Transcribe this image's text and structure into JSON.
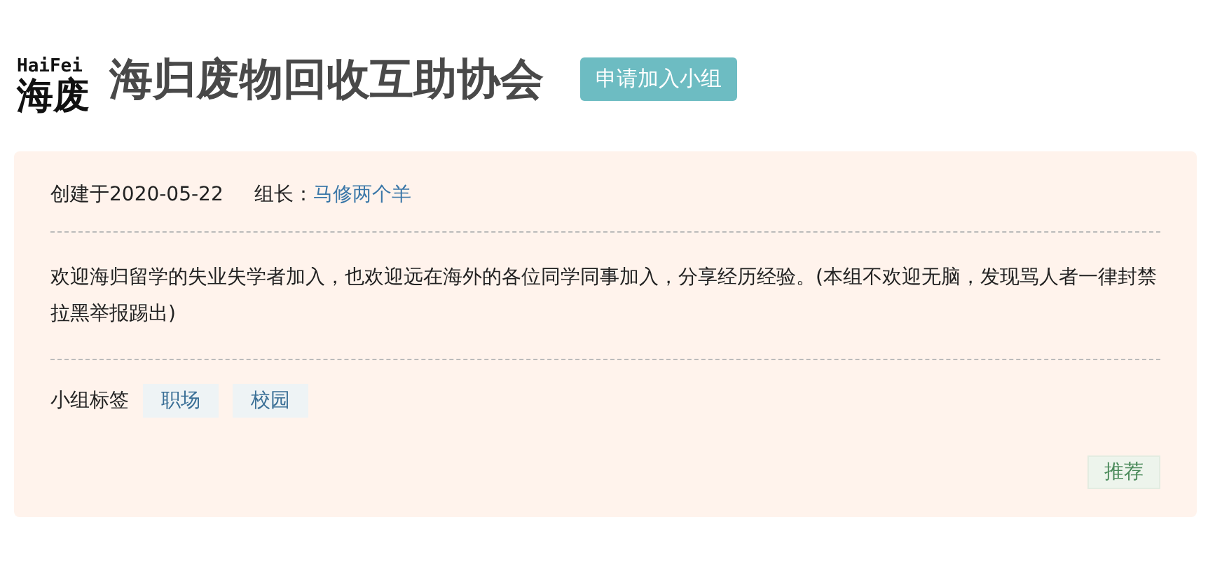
{
  "header": {
    "logo_latin": "HaiFei",
    "logo_cn": "海废",
    "title": "海归废物回收互助协会",
    "join_button": "申请加入小组"
  },
  "info": {
    "created": "创建于2020-05-22",
    "owner_label": "组长：",
    "owner_name": "马修两个羊"
  },
  "description": "欢迎海归留学的失业失学者加入，也欢迎远在海外的各位同学同事加入，分享经历经验。(本组不欢迎无脑，发现骂人者一律封禁拉黑举报踢出)",
  "tags_label": "小组标签",
  "tags": [
    "职场",
    "校园"
  ],
  "recommend_button": "推荐"
}
